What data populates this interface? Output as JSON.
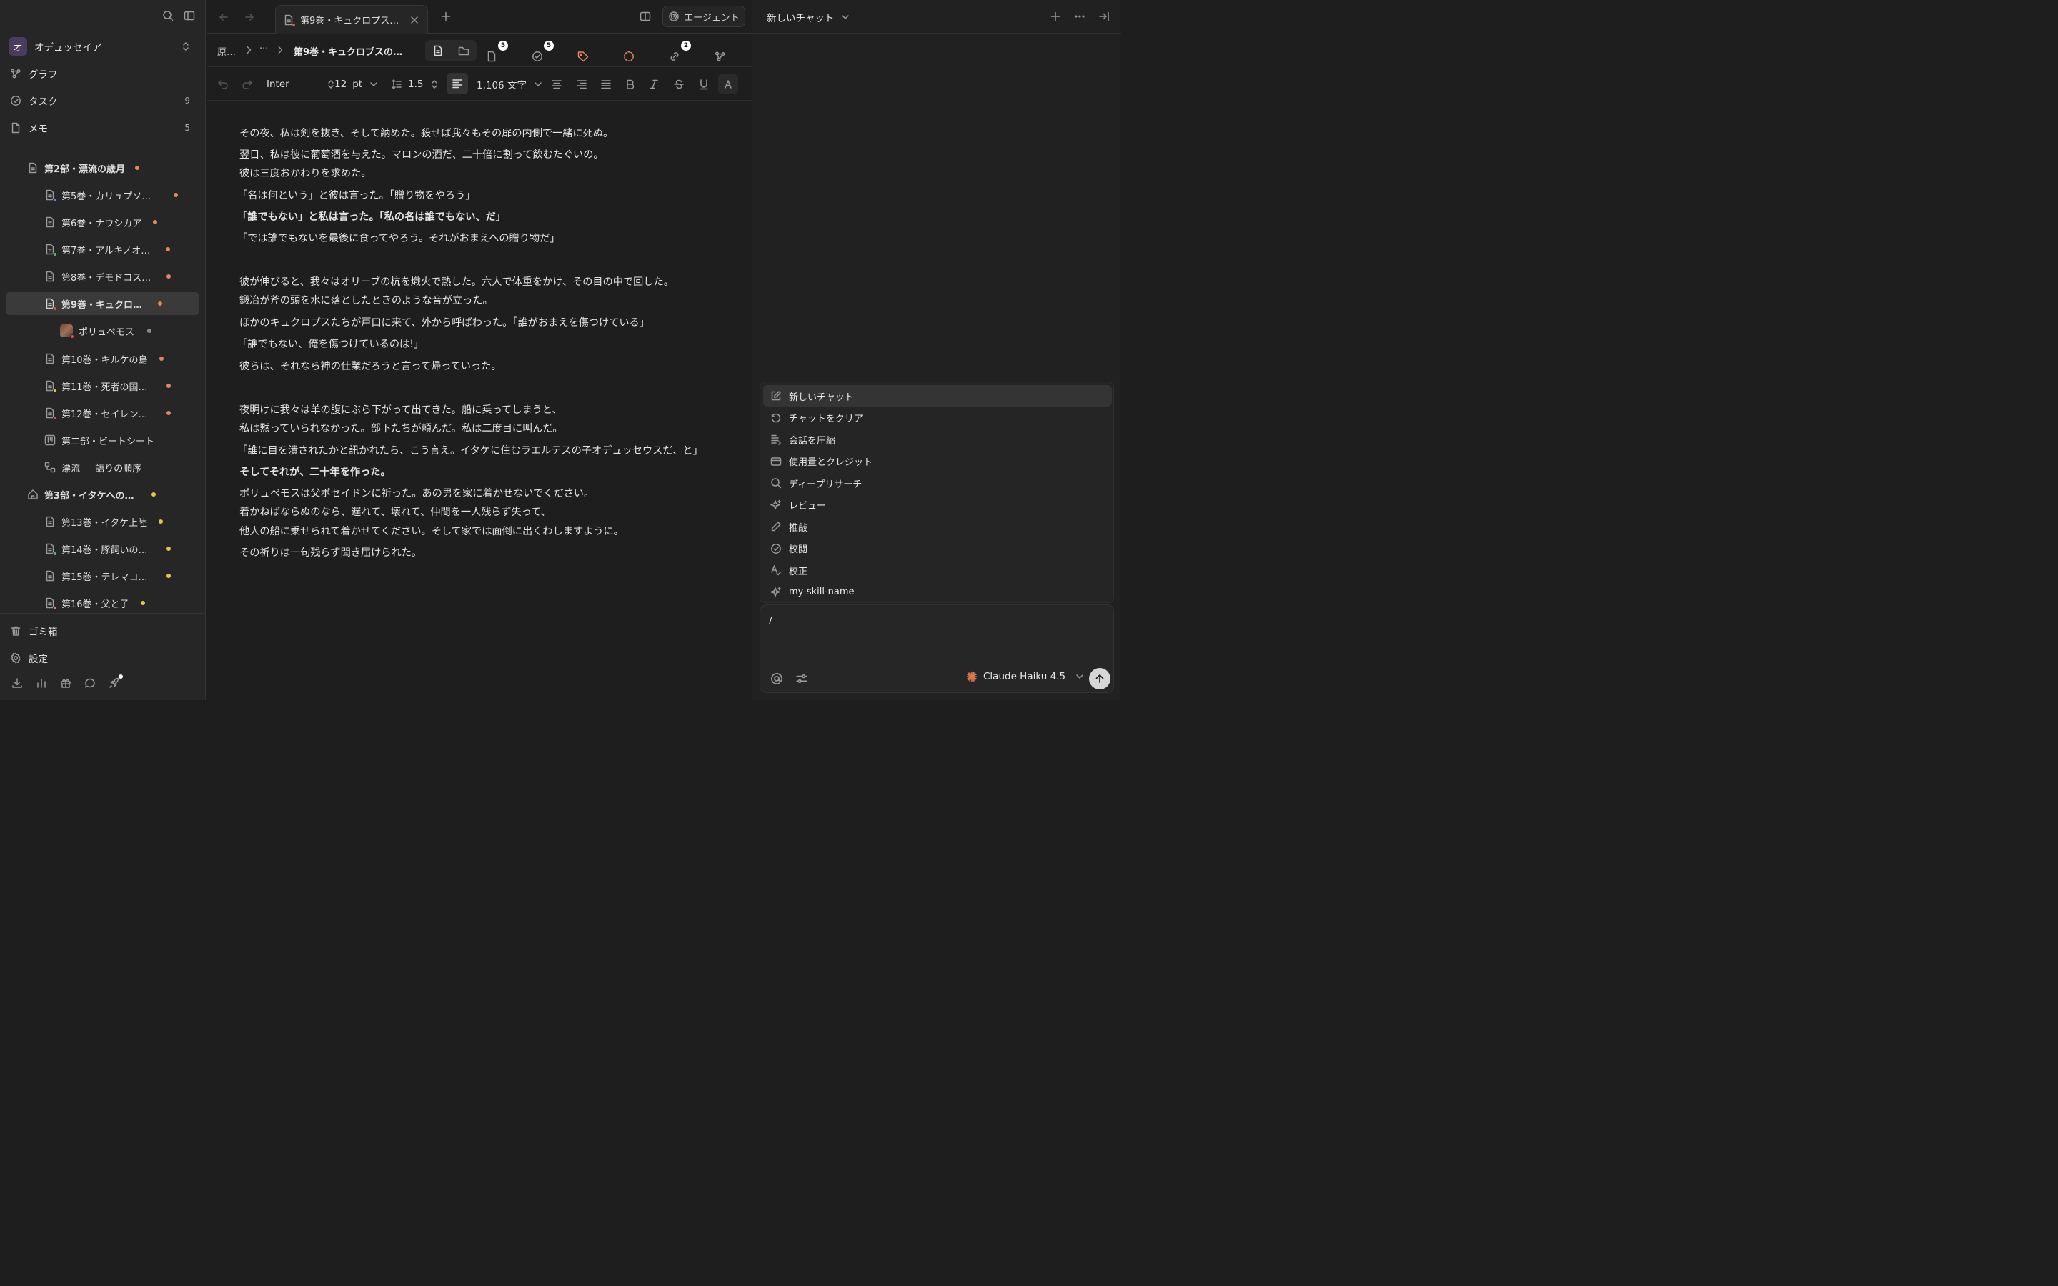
{
  "sidebar": {
    "workspace": {
      "avatar": "オ",
      "name": "オデュッセイア"
    },
    "nav": [
      {
        "label": "グラフ",
        "count": ""
      },
      {
        "label": "タスク",
        "count": "9"
      },
      {
        "label": "メモ",
        "count": "5"
      }
    ],
    "tree": [
      {
        "label": "第2部・漂流の歳月"
      },
      {
        "label": "第5巻・カリュプソ…"
      },
      {
        "label": "第6巻・ナウシカア"
      },
      {
        "label": "第7巻・アルキノオ…"
      },
      {
        "label": "第8巻・デモドコス…"
      },
      {
        "label": "第9巻・キュクロ…"
      },
      {
        "label": "ポリュペモス"
      },
      {
        "label": "第10巻・キルケの島"
      },
      {
        "label": "第11巻・死者の国…"
      },
      {
        "label": "第12巻・セイレン…"
      },
      {
        "label": "第二部・ビートシート"
      },
      {
        "label": "漂流 — 語りの順序"
      },
      {
        "label": "第3部・イタケへの…"
      },
      {
        "label": "第13巻・イタケ上陸"
      },
      {
        "label": "第14巻・豚飼いの…"
      },
      {
        "label": "第15巻・テレマコ…"
      },
      {
        "label": "第16巻・父と子"
      }
    ],
    "bottom": {
      "trash": "ゴミ箱",
      "settings": "設定"
    }
  },
  "editor": {
    "tab_title": "第9巻・キュクロプス…",
    "agent_label": "エージェント",
    "breadcrumb": {
      "root": "原…",
      "ellipsis": "···",
      "current": "第9巻・キュクロプスの…"
    },
    "badges": {
      "notes": "5",
      "tasks": "5",
      "links": "2"
    },
    "format": {
      "font": "Inter",
      "size": "12",
      "unit": "pt",
      "line_height": "1.5",
      "word_count": "1,106 文字"
    },
    "paragraphs": [
      "その夜、私は剣を抜き、そして納めた。殺せば我々もその扉の内側で一緒に死ぬ。",
      "翌日、私は彼に葡萄酒を与えた。マロンの酒だ、二十倍に割って飲むたぐいの。",
      "彼は三度おかわりを求めた。",
      "「名は何という」と彼は言った。「贈り物をやろう」",
      "「誰でもない」と私は言った。「私の名は誰でもない、だ」",
      "「では誰でもないを最後に食ってやろう。それがおまえへの贈り物だ」",
      "彼が伸びると、我々はオリーブの杭を熾火で熱した。六人で体重をかけ、その目の中で回した。",
      "鍛冶が斧の頭を水に落としたときのような音が立った。",
      "ほかのキュクロプスたちが戸口に来て、外から呼ばわった。「誰がおまえを傷つけている」",
      "「誰でもない、俺を傷つけているのは!」",
      "彼らは、それなら神の仕業だろうと言って帰っていった。",
      "夜明けに我々は羊の腹にぶら下がって出てきた。船に乗ってしまうと、",
      "私は黙っていられなかった。部下たちが頼んだ。私は二度目に叫んだ。",
      "「誰に目を潰されたかと訊かれたら、こう言え。イタケに住むラエルテスの子オデュッセウスだ、と」",
      "そしてそれが、二十年を作った。",
      "ポリュペモスは父ポセイドンに祈った。あの男を家に着かせないでください。",
      "着かねばならぬのなら、遅れて、壊れて、仲間を一人残らず失って、",
      "他人の船に乗せられて着かせてください。そして家では面倒に出くわしますように。",
      "その祈りは一句残らず聞き届けられた。"
    ]
  },
  "chat": {
    "title": "新しいチャット",
    "menu": [
      "新しいチャット",
      "チャットをクリア",
      "会話を圧縮",
      "使用量とクレジット",
      "ディープリサーチ",
      "レビュー",
      "推敲",
      "校閲",
      "校正",
      "my-skill-name"
    ],
    "input_value": "/",
    "model": "Claude Haiku 4.5"
  },
  "colors": {
    "accent_orange": "#e8845a",
    "dot_yellow": "#e6c34a",
    "dot_gray": "#8a8a8a",
    "dot_green": "#5fb36a",
    "dot_blue": "#5a8de8",
    "dot_red": "#d9534f"
  }
}
